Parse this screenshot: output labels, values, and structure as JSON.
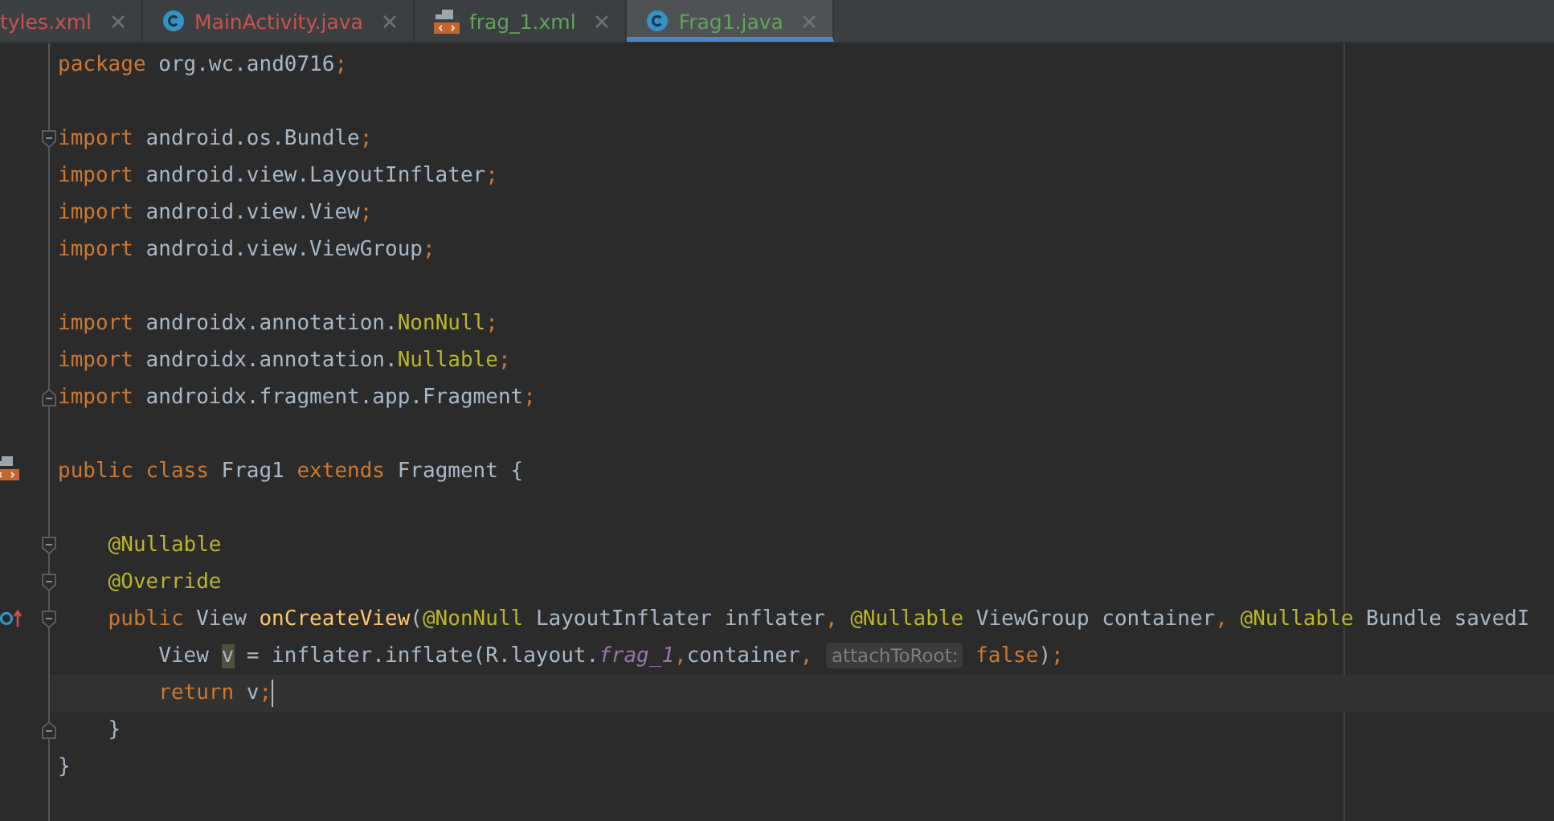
{
  "tabs": [
    {
      "label": "tyles.xml",
      "color": "#c75450",
      "selected": false
    },
    {
      "label": "MainActivity.java",
      "color": "#c75450",
      "kind": "class",
      "selected": false
    },
    {
      "label": "frag_1.xml",
      "color": "#62a35c",
      "kind": "layout",
      "selected": false
    },
    {
      "label": "Frag1.java",
      "color": "#62a35c",
      "kind": "class",
      "selected": true
    }
  ],
  "editor": {
    "lines": [
      {
        "kind": "code",
        "tokens": [
          {
            "kind": "keyword",
            "text": "package "
          },
          {
            "kind": "plain",
            "text": "org.wc.and0716"
          },
          {
            "kind": "keyword",
            "text": ";"
          }
        ]
      },
      {
        "kind": "blank"
      },
      {
        "kind": "code",
        "markers": [
          {
            "kind": "fold_start"
          }
        ],
        "tokens": [
          {
            "kind": "keyword",
            "text": "import "
          },
          {
            "kind": "plain",
            "text": "android.os.Bundle"
          },
          {
            "kind": "keyword",
            "text": ";"
          }
        ]
      },
      {
        "kind": "code",
        "tokens": [
          {
            "kind": "keyword",
            "text": "import "
          },
          {
            "kind": "plain",
            "text": "android.view.LayoutInflater"
          },
          {
            "kind": "keyword",
            "text": ";"
          }
        ]
      },
      {
        "kind": "code",
        "tokens": [
          {
            "kind": "keyword",
            "text": "import "
          },
          {
            "kind": "plain",
            "text": "android.view.View"
          },
          {
            "kind": "keyword",
            "text": ";"
          }
        ]
      },
      {
        "kind": "code",
        "tokens": [
          {
            "kind": "keyword",
            "text": "import "
          },
          {
            "kind": "plain",
            "text": "android.view.ViewGroup"
          },
          {
            "kind": "keyword",
            "text": ";"
          }
        ]
      },
      {
        "kind": "blank"
      },
      {
        "kind": "code",
        "tokens": [
          {
            "kind": "keyword",
            "text": "import "
          },
          {
            "kind": "plain",
            "text": "androidx.annotation."
          },
          {
            "kind": "annotation",
            "text": "NonNull"
          },
          {
            "kind": "keyword",
            "text": ";"
          }
        ]
      },
      {
        "kind": "code",
        "tokens": [
          {
            "kind": "keyword",
            "text": "import "
          },
          {
            "kind": "plain",
            "text": "androidx.annotation."
          },
          {
            "kind": "annotation",
            "text": "Nullable"
          },
          {
            "kind": "keyword",
            "text": ";"
          }
        ]
      },
      {
        "kind": "code",
        "markers": [
          {
            "kind": "fold_end"
          }
        ],
        "tokens": [
          {
            "kind": "keyword",
            "text": "import "
          },
          {
            "kind": "plain",
            "text": "androidx.fragment.app.Fragment"
          },
          {
            "kind": "keyword",
            "text": ";"
          }
        ]
      },
      {
        "kind": "blank"
      },
      {
        "kind": "code",
        "markers": [
          {
            "kind": "layout"
          }
        ],
        "tokens": [
          {
            "kind": "keyword",
            "text": "public class "
          },
          {
            "kind": "plain",
            "text": "Frag1 "
          },
          {
            "kind": "keyword",
            "text": "extends "
          },
          {
            "kind": "plain",
            "text": "Fragment {"
          }
        ]
      },
      {
        "kind": "blank"
      },
      {
        "kind": "code",
        "markers": [
          {
            "kind": "fold_start"
          }
        ],
        "tokens": [
          {
            "kind": "annotation",
            "text": "    @Nullable"
          }
        ]
      },
      {
        "kind": "code",
        "markers": [
          {
            "kind": "fold_start"
          }
        ],
        "tokens": [
          {
            "kind": "annotation",
            "text": "    @Override"
          }
        ]
      },
      {
        "kind": "code",
        "markers": [
          {
            "kind": "override"
          },
          {
            "kind": "fold_start"
          }
        ],
        "tokens": [
          {
            "kind": "keyword",
            "text": "    public "
          },
          {
            "kind": "plain",
            "text": "View "
          },
          {
            "kind": "method",
            "text": "onCreateView"
          },
          {
            "kind": "plain",
            "text": "("
          },
          {
            "kind": "annotation",
            "text": "@NonNull "
          },
          {
            "kind": "plain",
            "text": "LayoutInflater inflater"
          },
          {
            "kind": "keyword",
            "text": ", "
          },
          {
            "kind": "annotation",
            "text": "@Nullable "
          },
          {
            "kind": "plain",
            "text": "ViewGroup container"
          },
          {
            "kind": "keyword",
            "text": ", "
          },
          {
            "kind": "annotation",
            "text": "@Nullable "
          },
          {
            "kind": "plain",
            "text": "Bundle savedI"
          }
        ]
      },
      {
        "kind": "code",
        "tokens": [
          {
            "kind": "plain",
            "text": "        View "
          },
          {
            "kind": "highlight",
            "text": "v"
          },
          {
            "kind": "plain",
            "text": " = inflater.inflate(R.layout."
          },
          {
            "kind": "field",
            "text": "frag_1"
          },
          {
            "kind": "keyword",
            "text": ","
          },
          {
            "kind": "plain",
            "text": "container"
          },
          {
            "kind": "keyword",
            "text": ", "
          },
          {
            "kind": "hint",
            "text": "attachToRoot:"
          },
          {
            "kind": "keyword",
            "text": " false"
          },
          {
            "kind": "plain",
            "text": ")"
          },
          {
            "kind": "keyword",
            "text": ";"
          }
        ]
      },
      {
        "kind": "code",
        "current": true,
        "tokens": [
          {
            "kind": "keyword",
            "text": "        return "
          },
          {
            "kind": "plain",
            "text": "v"
          },
          {
            "kind": "keyword",
            "text": ";"
          }
        ]
      },
      {
        "kind": "code",
        "markers": [
          {
            "kind": "fold_end"
          }
        ],
        "tokens": [
          {
            "kind": "plain",
            "text": "    }"
          }
        ]
      },
      {
        "kind": "code",
        "tokens": [
          {
            "kind": "plain",
            "text": "}"
          }
        ]
      }
    ]
  }
}
